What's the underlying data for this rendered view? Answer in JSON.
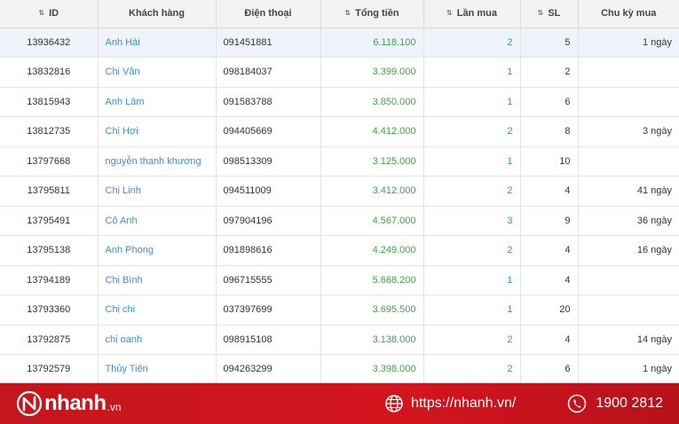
{
  "table": {
    "columns": [
      {
        "key": "id",
        "label": "ID",
        "sortable": true
      },
      {
        "key": "customer",
        "label": "Khách hàng",
        "sortable": false
      },
      {
        "key": "phone",
        "label": "Điện thoại",
        "sortable": false
      },
      {
        "key": "total",
        "label": "Tổng tiền",
        "sortable": true
      },
      {
        "key": "times",
        "label": "Lần mua",
        "sortable": true
      },
      {
        "key": "qty",
        "label": "SL",
        "sortable": true
      },
      {
        "key": "cycle",
        "label": "Chu kỳ mua",
        "sortable": false
      }
    ],
    "rows": [
      {
        "id": "13936432",
        "customer": "Anh Hải",
        "phone": "091451881",
        "total": "6.118.100",
        "times": "2",
        "qty": "5",
        "cycle": "1 ngày"
      },
      {
        "id": "13832816",
        "customer": "Chị Vân",
        "phone": "098184037",
        "total": "3.399.000",
        "times": "1",
        "qty": "2",
        "cycle": ""
      },
      {
        "id": "13815943",
        "customer": "Anh Lâm",
        "phone": "091583788",
        "total": "3.850.000",
        "times": "1",
        "qty": "6",
        "cycle": ""
      },
      {
        "id": "13812735",
        "customer": "Chị Hợi",
        "phone": "094405669",
        "total": "4.412.000",
        "times": "2",
        "qty": "8",
        "cycle": "3 ngày"
      },
      {
        "id": "13797668",
        "customer": "nguyễn thanh khương",
        "phone": "098513309",
        "total": "3.125.000",
        "times": "1",
        "qty": "10",
        "cycle": ""
      },
      {
        "id": "13795811",
        "customer": "Chị Linh",
        "phone": "094511009",
        "total": "3.412.000",
        "times": "2",
        "qty": "4",
        "cycle": "41 ngày"
      },
      {
        "id": "13795491",
        "customer": "Cô Anh",
        "phone": "097904196",
        "total": "4.567.000",
        "times": "3",
        "qty": "9",
        "cycle": "36 ngày"
      },
      {
        "id": "13795138",
        "customer": "Anh Phong",
        "phone": "091898616",
        "total": "4.249.000",
        "times": "2",
        "qty": "4",
        "cycle": "16 ngày"
      },
      {
        "id": "13794189",
        "customer": "Chị Bình",
        "phone": "096715555",
        "total": "5.668.200",
        "times": "1",
        "qty": "4",
        "cycle": ""
      },
      {
        "id": "13793360",
        "customer": "Chị chi",
        "phone": "037397699",
        "total": "3.695.500",
        "times": "1",
        "qty": "20",
        "cycle": ""
      },
      {
        "id": "13792875",
        "customer": "chị oanh",
        "phone": "098915108",
        "total": "3.138.000",
        "times": "2",
        "qty": "4",
        "cycle": "14 ngày"
      },
      {
        "id": "13792579",
        "customer": "Thủy Tiên",
        "phone": "094263299",
        "total": "3.398.000",
        "times": "2",
        "qty": "6",
        "cycle": "1 ngày"
      }
    ]
  },
  "footer": {
    "brand": "nhanh",
    "brand_suffix": ".vn",
    "website": "https://nhanh.vn/",
    "hotline": "1900 2812",
    "icons": {
      "logo": "nhanh-logo-icon",
      "web": "globe-icon",
      "phone": "phone-icon"
    }
  },
  "colors": {
    "link": "#3a8fd6",
    "amount": "#3aa545",
    "footer_bg": "#c4161c",
    "row_highlight": "#eef4fa"
  }
}
